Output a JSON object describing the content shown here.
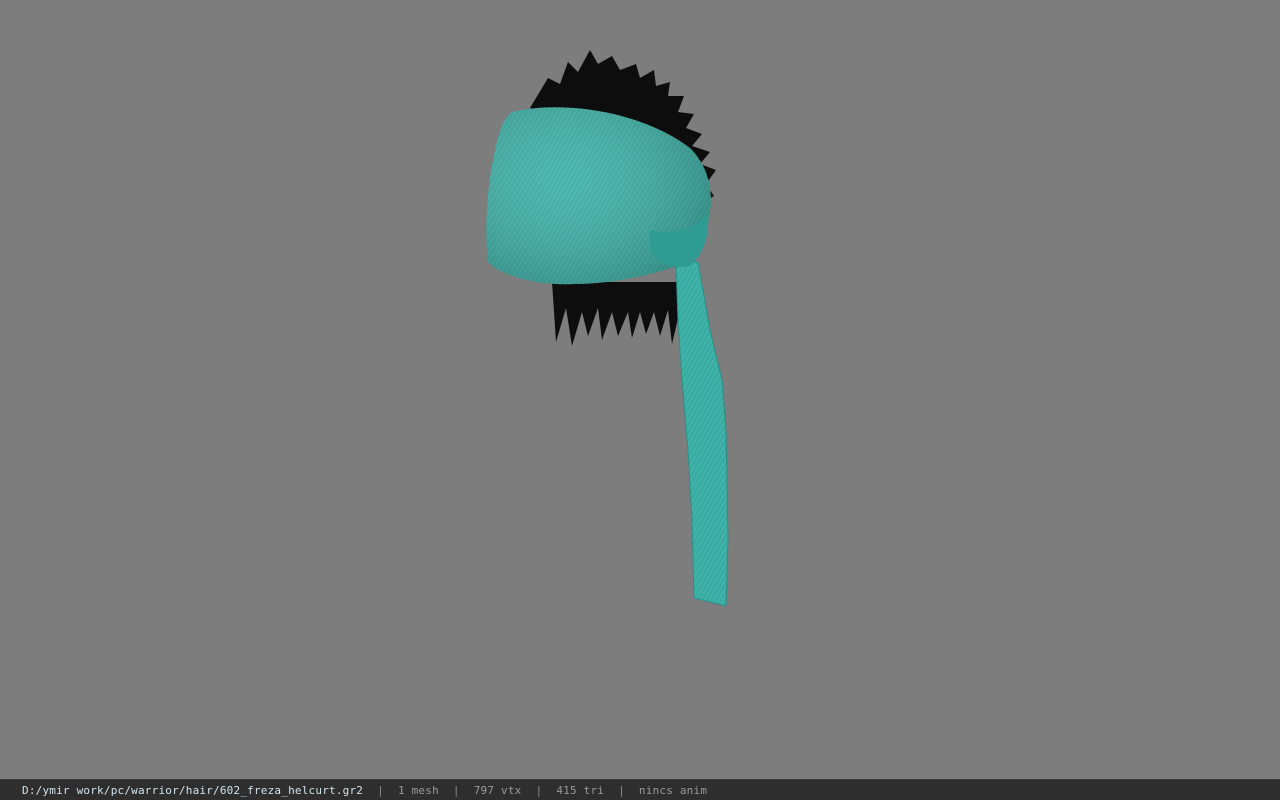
{
  "viewport": {
    "background_color": "#7d7d7d",
    "model": {
      "cloth_color": "#3fb3a9",
      "cloth_shadow_color": "#2a8f87",
      "hair_color": "#0d0d0d"
    }
  },
  "statusbar": {
    "file_path": "D:/ymir work/pc/warrior/hair/602_freza_helcurt.gr2",
    "separator": "|",
    "mesh_count": "1 mesh",
    "vertex_count": "797 vtx",
    "triangle_count": "415 tri",
    "anim_label": "nincs anim"
  }
}
